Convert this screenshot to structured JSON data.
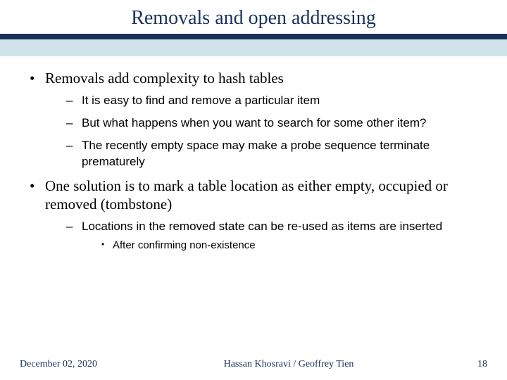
{
  "title": "Removals and open addressing",
  "bullets": {
    "b1": "Removals add complexity to hash tables",
    "b1_sub": {
      "s1": "It is easy to find and remove a particular item",
      "s2": "But what happens when you want to search for some other item?",
      "s3": "The recently empty space may make a probe sequence terminate prematurely"
    },
    "b2": "One solution is to mark a table location as either empty, occupied or removed (tombstone)",
    "b2_sub": {
      "s1": "Locations in the removed state can be re-used as items are inserted",
      "s1_sub": {
        "t1": "After confirming non-existence"
      }
    }
  },
  "footer": {
    "date": "December 02, 2020",
    "authors": "Hassan Khosravi / Geoffrey Tien",
    "page": "18"
  },
  "colors": {
    "navy": "#18315b",
    "lightblue": "#cfe2ea"
  }
}
